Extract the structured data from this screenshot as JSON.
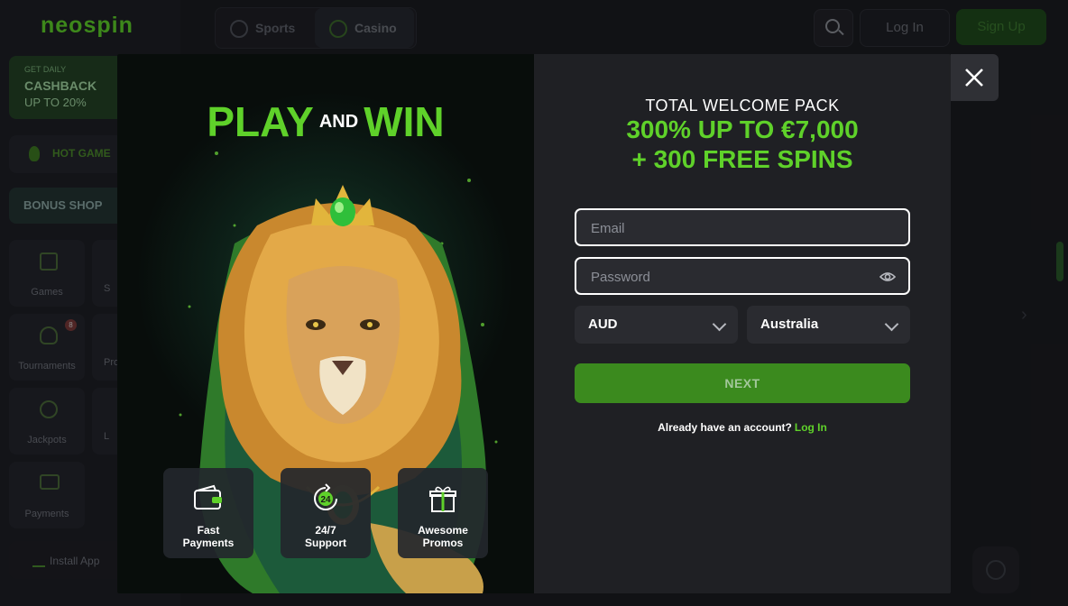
{
  "background": {
    "logo": "neospin",
    "cashback": {
      "small": "GET DAILY",
      "big": "CASHBACK",
      "percent": "UP TO 20%"
    },
    "hot_games": "HOT GAME",
    "bonus_shop": "BONUS SHOP",
    "tiles": [
      {
        "label": "Games",
        "icon": "dice-icon"
      },
      {
        "label": "Tournaments",
        "icon": "trophy-icon",
        "badge": "8"
      },
      {
        "label": "Jackpots",
        "icon": "money-bag-icon"
      },
      {
        "label": "Payments",
        "icon": "payment-icon"
      }
    ],
    "partial_tiles": [
      "S",
      "Pro",
      "L"
    ],
    "install_app": "Install App",
    "header_tabs": {
      "sports": "Sports",
      "casino": "Casino"
    },
    "login": "Log In",
    "signup": "Sign Up"
  },
  "modal": {
    "promo": {
      "headline_left": "PLAY",
      "headline_and": "AND",
      "headline_right": "WIN",
      "features": [
        {
          "icon": "wallet-icon",
          "line1": "Fast",
          "line2": "Payments"
        },
        {
          "icon": "clock-24-icon",
          "line1": "24/7",
          "line2": "Support"
        },
        {
          "icon": "gift-icon",
          "line1": "Awesome",
          "line2": "Promos"
        }
      ]
    },
    "form": {
      "pack_title": "TOTAL WELCOME PACK",
      "pack_line1": "300% UP TO €7,000",
      "pack_line2": "+ 300 FREE SPINS",
      "email_placeholder": "Email",
      "password_placeholder": "Password",
      "currency": "AUD",
      "country": "Australia",
      "next_label": "NEXT",
      "already_text": "Already have an account?",
      "login_link": "Log In"
    }
  },
  "colors": {
    "accent": "#5fd12a",
    "button": "#3b8a1e",
    "panel": "#1f2024"
  }
}
